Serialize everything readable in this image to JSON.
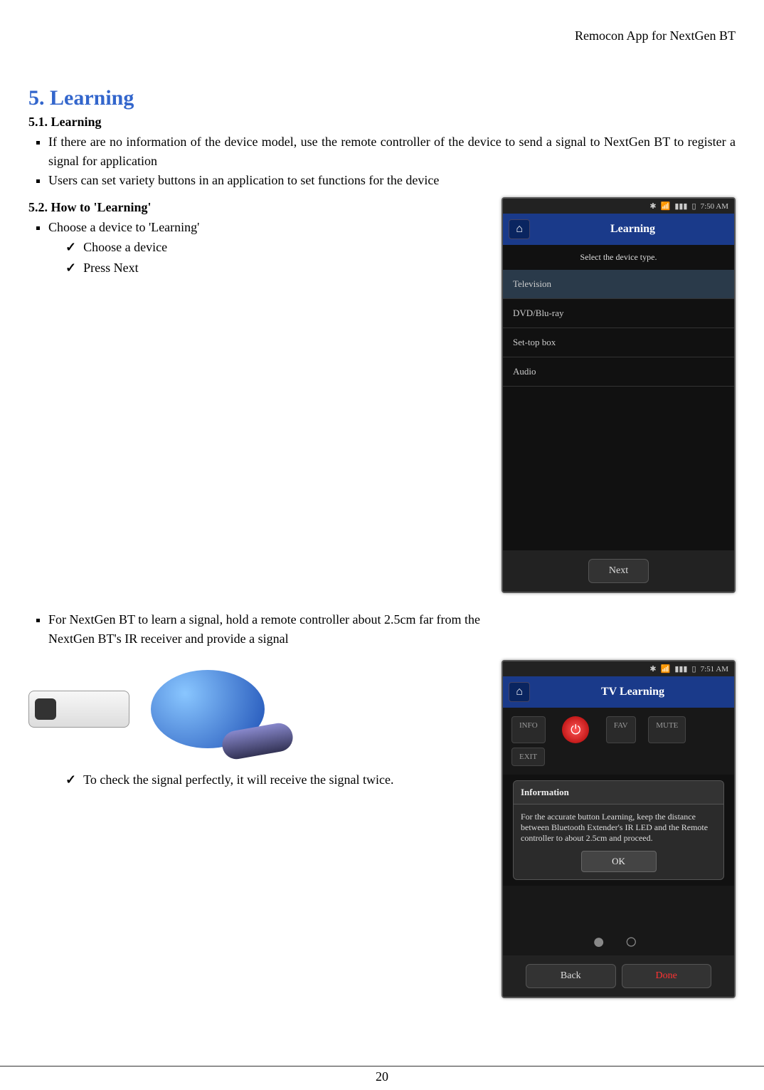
{
  "header": {
    "right_text": "Remocon App for NextGen BT"
  },
  "section": {
    "title": "5. Learning"
  },
  "s51": {
    "heading": "5.1. Learning",
    "b1": "If there are no information of the device model, use the remote controller of the device to send a signal to NextGen BT to register a signal for application",
    "b2": "Users can set variety buttons in an application to set functions for the device"
  },
  "s52": {
    "heading": "5.2. How to 'Learning'",
    "b1": "Choose a device to 'Learning'",
    "c1": "Choose a device",
    "c2": "Press Next",
    "b2": "For NextGen BT to learn a signal, hold a remote controller about 2.5cm far from the NextGen BT's IR receiver and provide a signal",
    "c3": "To check the signal perfectly, it will receive the signal twice."
  },
  "phone1": {
    "time": "7:50 AM",
    "title": "Learning",
    "hint": "Select the device type.",
    "items": [
      "Television",
      "DVD/Blu-ray",
      "Set-top box",
      "Audio"
    ],
    "next": "Next"
  },
  "phone2": {
    "time": "7:51 AM",
    "title": "TV Learning",
    "info_btn": "INFO",
    "fav_btn": "FAV",
    "mute_btn": "MUTE",
    "exit_btn": "EXIT",
    "pop_title": "Information",
    "pop_body": "For the accurate button Learning, keep the distance between Bluetooth Extender's IR LED and the Remote controller to about 2.5cm and proceed.",
    "ok": "OK",
    "back": "Back",
    "done": "Done"
  },
  "footer": {
    "page_no": "20"
  }
}
